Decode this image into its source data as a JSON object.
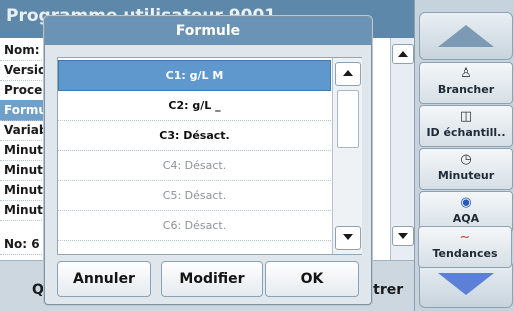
{
  "background": {
    "title": "Programme utilisateur 9001",
    "rows": [
      "Nom: P",
      "Version",
      "Process",
      "Formul",
      "Variabl",
      "Minute",
      "Minute",
      "Minute",
      "Minute",
      "No: 6"
    ],
    "highlighted_row": 3,
    "footer_left": "Qu",
    "footer_right": "istrer"
  },
  "sidebar": {
    "buttons": [
      {
        "label": "Brancher",
        "icon": "person-plug-icon"
      },
      {
        "label": "ID échantill..",
        "icon": "sample-bottle-icon"
      },
      {
        "label": "Minuteur",
        "icon": "timer-icon"
      },
      {
        "label": "AQA",
        "icon": "quality-assurance-icon"
      },
      {
        "label": "Tendances",
        "icon": "trend-chart-icon"
      }
    ]
  },
  "dialog": {
    "title": "Formule",
    "items": [
      "C1: g/L M",
      "C2: g/L _",
      "C3: Désact.",
      "C4: Désact.",
      "C5: Désact.",
      "C6: Désact."
    ],
    "selected_index": 0,
    "buttons": {
      "cancel": "Annuler",
      "modify": "Modifier",
      "ok": "OK"
    }
  },
  "colors": {
    "header": "#5e88aa",
    "selected": "#5f98cc",
    "dialog_title": "#6a93b6"
  }
}
